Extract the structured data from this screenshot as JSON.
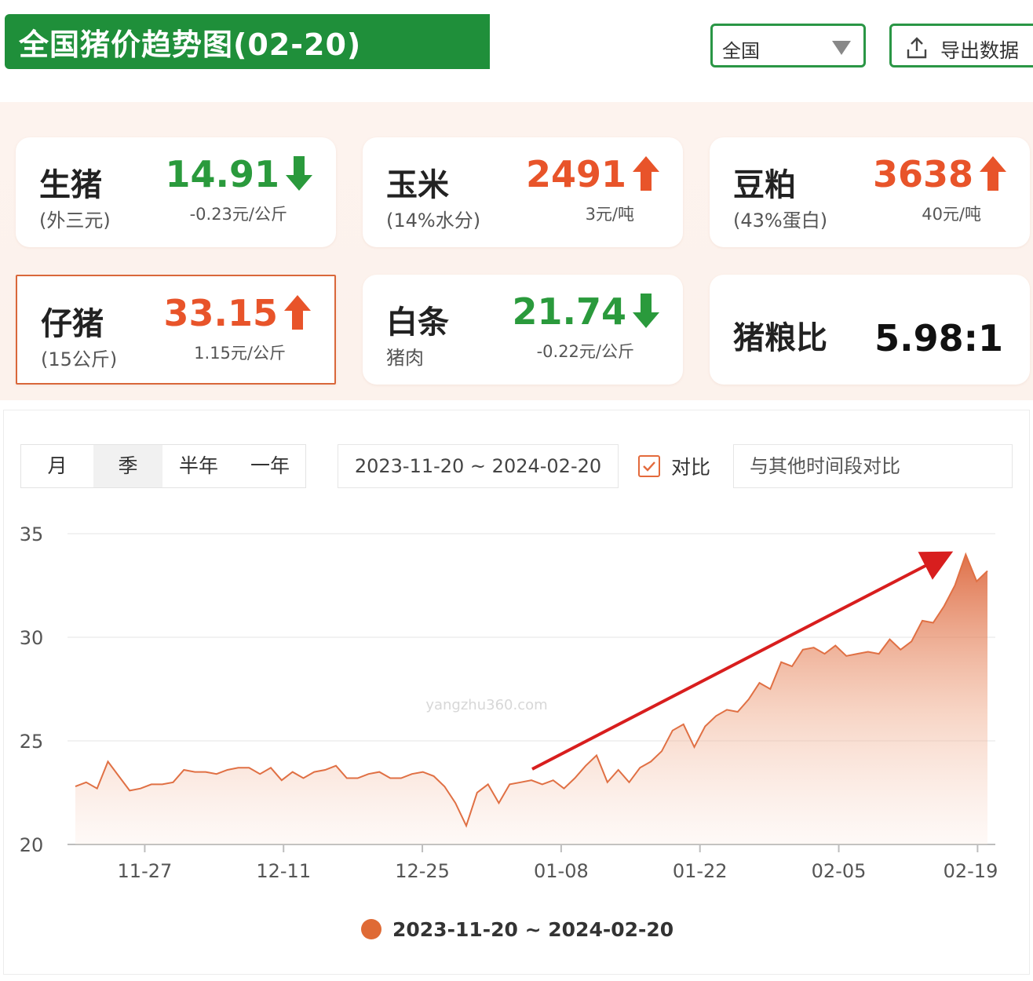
{
  "header": {
    "title": "全国猪价趋势图(02-20)",
    "region_select": "全国",
    "export_label": "导出数据"
  },
  "cards": {
    "live_hog": {
      "name": "生猪",
      "sub": "(外三元)",
      "value": "14.91",
      "change": "-0.23元/公斤",
      "direction": "down"
    },
    "corn": {
      "name": "玉米",
      "sub": "(14%水分)",
      "value": "2491",
      "change": "3元/吨",
      "direction": "up"
    },
    "soymeal": {
      "name": "豆粕",
      "sub": "(43%蛋白)",
      "value": "3638",
      "change": "40元/吨",
      "direction": "up"
    },
    "piglet": {
      "name": "仔猪",
      "sub": "(15公斤)",
      "value": "33.15",
      "change": "1.15元/公斤",
      "direction": "up"
    },
    "carcass": {
      "name": "白条",
      "sub": "猪肉",
      "value": "21.74",
      "change": "-0.22元/公斤",
      "direction": "down"
    },
    "ratio": {
      "name": "猪粮比",
      "value": "5.98:1"
    }
  },
  "controls": {
    "periods": [
      "月",
      "季",
      "半年",
      "一年"
    ],
    "active_period": "季",
    "date_range": "2023-11-20 ~ 2024-02-20",
    "compare_label": "对比",
    "compare_placeholder": "与其他时间段对比"
  },
  "colors": {
    "accent_green": "#1f8f3a",
    "up_red": "#e8542a",
    "down_green": "#2a9a3c",
    "series": "#df6a35"
  },
  "chart_data": {
    "type": "area",
    "ylim": [
      20,
      35
    ],
    "yticks": [
      20,
      25,
      30,
      35
    ],
    "xticks": [
      "11-27",
      "12-11",
      "12-25",
      "01-08",
      "01-22",
      "02-05",
      "02-19"
    ],
    "legend": "2023-11-20 ~ 2024-02-20",
    "watermark_text": "yangzhu360.com",
    "annotation": "upward trend arrow",
    "series": [
      {
        "values": [
          22.8,
          23.0,
          22.7,
          24.0,
          23.3,
          22.6,
          22.7,
          22.9,
          22.9,
          23.0,
          23.6,
          23.5,
          23.5,
          23.4,
          23.6,
          23.7,
          23.7,
          23.4,
          23.7,
          23.1,
          23.5,
          23.2,
          23.5,
          23.6,
          23.8,
          23.2,
          23.2,
          23.4,
          23.5,
          23.2,
          23.2,
          23.4,
          23.5,
          23.3,
          22.8,
          22.0,
          20.9,
          22.5,
          22.9,
          22.0,
          22.9,
          23.0,
          23.1,
          22.9,
          23.1,
          22.7,
          23.2,
          23.8,
          24.3,
          23.0,
          23.6,
          23.0,
          23.7,
          24.0,
          24.5,
          25.5,
          25.8,
          24.7,
          25.7,
          26.2,
          26.5,
          26.4,
          27.0,
          27.8,
          27.5,
          28.8,
          28.6,
          29.4,
          29.5,
          29.2,
          29.6,
          29.1,
          29.2,
          29.3,
          29.2,
          29.9,
          29.4,
          29.8,
          30.8,
          30.7,
          31.5,
          32.5,
          34.0,
          32.7,
          33.2
        ]
      }
    ]
  }
}
